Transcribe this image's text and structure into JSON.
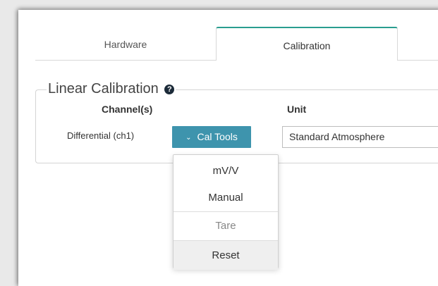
{
  "tabs": [
    {
      "label": "Hardware"
    },
    {
      "label": "Calibration"
    }
  ],
  "section": {
    "title": "Linear Calibration",
    "help_icon": "?"
  },
  "table": {
    "headers": {
      "channel": "Channel(s)",
      "unit": "Unit"
    },
    "row": {
      "channel": "Differential (ch1)",
      "tool_button": "Cal Tools",
      "tool_chevron": "⌄",
      "unit_value": "Standard Atmosphere"
    }
  },
  "dropdown_menu": {
    "items": [
      {
        "label": "mV/V",
        "state": "enabled"
      },
      {
        "label": "Manual",
        "state": "enabled"
      },
      {
        "label": "Tare",
        "state": "disabled"
      },
      {
        "label": "Reset",
        "state": "hovered"
      }
    ]
  },
  "colors": {
    "accent": "#3e94ad",
    "tab_active_border": "#2a9d8f"
  }
}
